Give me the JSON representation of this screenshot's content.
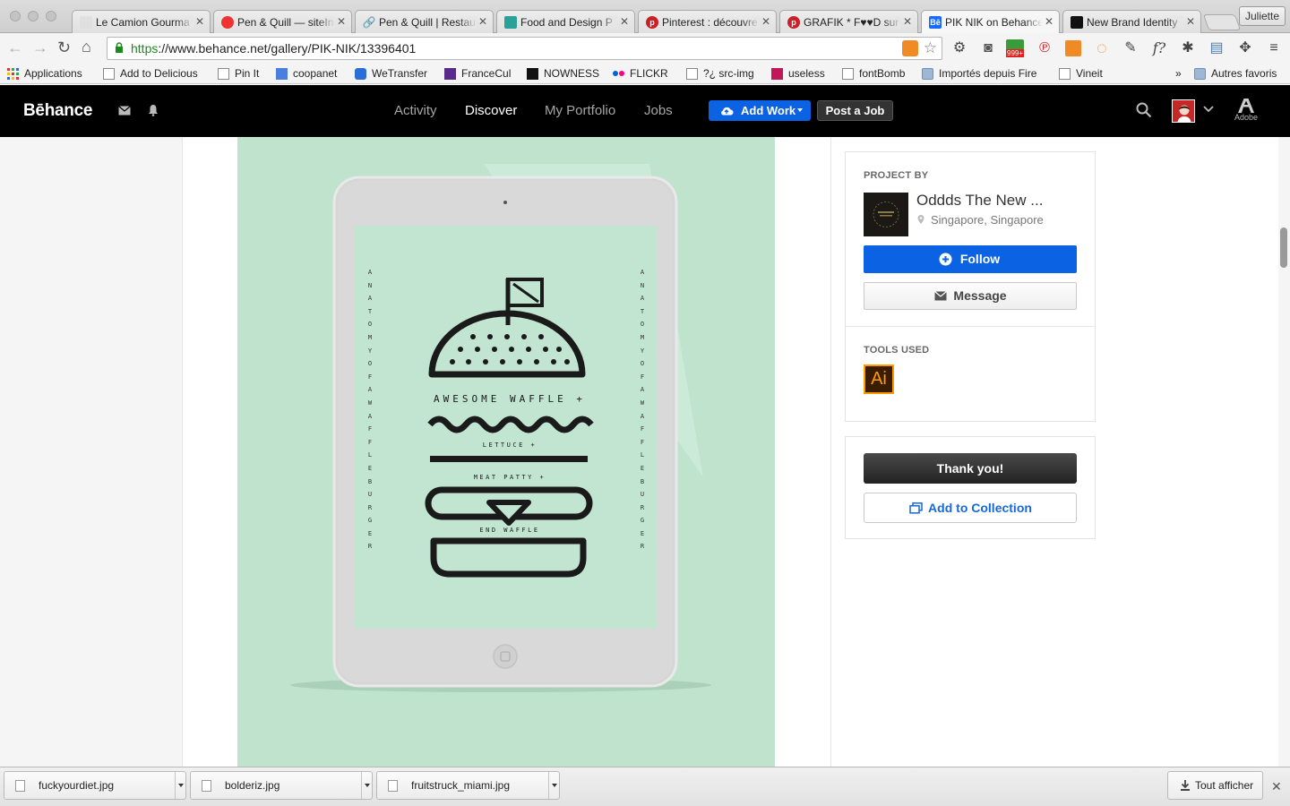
{
  "browser": {
    "tabs": [
      {
        "title": "Le Camion Gourma",
        "icon": "page-icon",
        "color": "#e0e0e0"
      },
      {
        "title": "Pen & Quill — siteIn",
        "icon": "circle-red-icon",
        "color": "#ee3333"
      },
      {
        "title": "Pen & Quill | Restau",
        "icon": "link-icon",
        "color": "#d08a40"
      },
      {
        "title": "Food and Design P",
        "icon": "tumblr-icon",
        "color": "#2aa198"
      },
      {
        "title": "Pinterest : découvre",
        "icon": "pinterest-icon",
        "color": "#cb2027"
      },
      {
        "title": "GRAFIK * F♥♥D sur",
        "icon": "pinterest-icon",
        "color": "#cb2027"
      },
      {
        "title": "PIK NIK on Behance",
        "icon": "behance-icon",
        "color": "#1769ff"
      },
      {
        "title": "New Brand Identity",
        "icon": "black-square-icon",
        "color": "#111111"
      }
    ],
    "profile_name": "Juliette",
    "url_scheme": "https",
    "url_rest": "://www.behance.net/gallery/PIK-NIK/13396401",
    "extension_badge": "999+",
    "bookmarks": [
      {
        "label": "Applications",
        "icon": "apps-grid-icon"
      },
      {
        "label": "Add to Delicious",
        "icon": "page-icon"
      },
      {
        "label": "Pin It",
        "icon": "page-icon"
      },
      {
        "label": "coopanet",
        "icon": "google-icon"
      },
      {
        "label": "WeTransfer",
        "icon": "wetransfer-icon"
      },
      {
        "label": "FranceCul",
        "icon": "francecul-icon"
      },
      {
        "label": "NOWNESS",
        "icon": "nowness-icon"
      },
      {
        "label": "FLICKR",
        "icon": "flickr-icon"
      },
      {
        "label": "?¿ src-img",
        "icon": "page-icon"
      },
      {
        "label": "useless",
        "icon": "useless-icon"
      },
      {
        "label": "fontBomb",
        "icon": "page-icon"
      },
      {
        "label": "Importés depuis Fire",
        "icon": "folder-icon"
      },
      {
        "label": "Vineit",
        "icon": "page-icon"
      }
    ],
    "bookmarks_overflow": "»",
    "other_bookmarks": "Autres favoris"
  },
  "behance": {
    "logo": "Bēhance",
    "nav": [
      "Activity",
      "Discover",
      "My Portfolio",
      "Jobs"
    ],
    "active_nav": "Discover",
    "add_work": "Add Work",
    "post_job": "Post a Job",
    "adobe_label": "Adobe"
  },
  "artwork": {
    "side_text": "ANATOMY OF A WAFFLE BURGER",
    "title": "AWESOME WAFFLE +",
    "lettuce": "LETTUCE +",
    "patty": "MEAT PATTY +",
    "end": "END WAFFLE"
  },
  "sidebar": {
    "project_by_label": "PROJECT BY",
    "owner_name": "Oddds The New ...",
    "owner_location": "Singapore, Singapore",
    "follow_label": "Follow",
    "message_label": "Message",
    "tools_label": "TOOLS USED",
    "tool_icon_text": "Ai",
    "thanks_label": "Thank you!",
    "add_collection_label": "Add to Collection"
  },
  "downloads": {
    "files": [
      "fuckyourdiet.jpg",
      "bolderiz.jpg",
      "fruitstruck_miami.jpg"
    ],
    "show_all": "Tout afficher"
  }
}
